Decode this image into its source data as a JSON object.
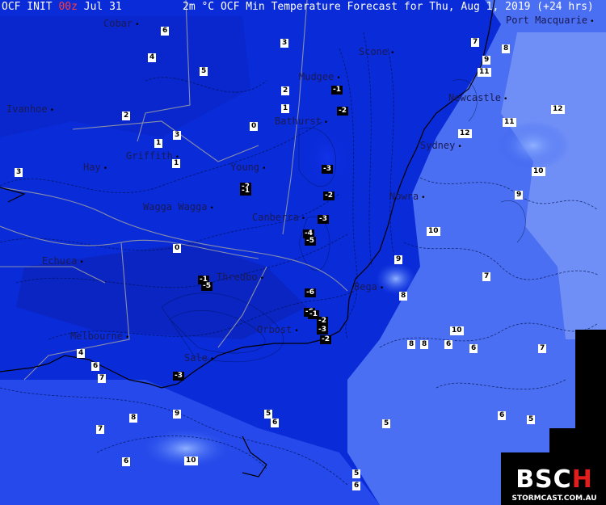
{
  "header": {
    "model": "OCF INIT",
    "run_hour": "00z",
    "init_date": "Jul 31",
    "title": "2m °C OCF Min Temperature Forecast for Thu, Aug 1, 2019 (+24 hrs)"
  },
  "towns": [
    "Cobar",
    "Port Macquarie",
    "Scone",
    "Mudgee",
    "Newcastle",
    "Ivanhoe",
    "Bathurst",
    "Sydney",
    "Hay",
    "Griffith",
    "Young",
    "Nowra",
    "Wagga Wagga",
    "Canberra",
    "Echuca",
    "Thredbo",
    "Bega",
    "Melbourne",
    "Orbost",
    "Sale"
  ],
  "temperature_labels": [
    "6",
    "4",
    "3",
    "5",
    "7",
    "8",
    "9",
    "11",
    "2",
    "1",
    "-1",
    "-2",
    "3",
    "0",
    "2",
    "1",
    "-2",
    "12",
    "11",
    "3",
    "1",
    "-1",
    "-3",
    "-3",
    "-2",
    "10",
    "9",
    "-5",
    "-4",
    "-1",
    "0",
    "-6",
    "-6",
    "-5",
    "9",
    "8",
    "7",
    "10",
    "12",
    "-5",
    "-1",
    "-3",
    "-2",
    "-2",
    "-3",
    "8",
    "8",
    "6",
    "10",
    "4",
    "6",
    "7",
    "6",
    "7",
    "9",
    "8",
    "5",
    "6",
    "7",
    "6",
    "5",
    "6",
    "10",
    "5",
    "6",
    "5"
  ],
  "logo": {
    "mark_main": "BSC",
    "mark_accent": "H",
    "site": "STORMCAST.COM.AU"
  },
  "colors": {
    "background": "#0a2bd8",
    "land_deep": "#0b2ce0",
    "sea_warm": "#6d8df5",
    "negative_box": "#000000"
  }
}
